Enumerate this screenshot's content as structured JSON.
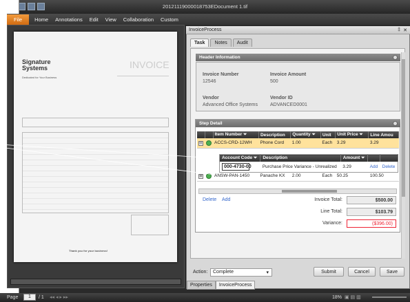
{
  "window": {
    "title": "20121119000018753EDocument 1.tif"
  },
  "menu": {
    "items": [
      "File",
      "Home",
      "Annotations",
      "Edit",
      "View",
      "Collaboration",
      "Custom"
    ]
  },
  "document": {
    "invoice_word": "INVOICE",
    "company": "Signature Systems",
    "tagline": "Dedicated for Your Business",
    "thanks": "Thank you for your business!"
  },
  "pane": {
    "title": "InvoiceProcess",
    "close": "✕",
    "pin": "‡"
  },
  "tabs": [
    "Task",
    "Notes",
    "Audit"
  ],
  "header_info": {
    "title": "Header Information",
    "invoice_number_label": "Invoice Number",
    "invoice_number": "12546",
    "invoice_amount_label": "Invoice Amount",
    "invoice_amount": "500",
    "vendor_label": "Vendor",
    "vendor": "Advanced Office Systems",
    "vendor_id_label": "Vendor ID",
    "vendor_id": "ADVANCED0001"
  },
  "step_detail": {
    "title": "Step Detail",
    "columns": [
      "Item Number",
      "Description",
      "Quantity",
      "Unit",
      "Unit Price",
      "Line Amou"
    ],
    "rows": [
      {
        "expander": "⊟",
        "item": "ACCS-CRD-12WH",
        "desc": "Phone Cord",
        "qty": "1.00",
        "unit": "Each",
        "price": "3.29",
        "amount": "3.29"
      },
      {
        "expander": "⊞",
        "item": "ANSW-PAN-1450",
        "desc": "Panache KX",
        "qty": "2.00",
        "unit": "Each",
        "price": "50.25",
        "amount": "100.50"
      }
    ],
    "sub_columns": [
      "Account Code",
      "Description",
      "Amount"
    ],
    "sub_row": {
      "account": "000-4730-00",
      "desc": "Purchase Price Variance - Unrealized",
      "amount": "3.29",
      "add": "Add",
      "delete": "Delete"
    },
    "delete": "Delete",
    "add": "Add",
    "invoice_total_label": "Invoice Total:",
    "invoice_total": "$500.00",
    "line_total_label": "Line Total:",
    "line_total": "$103.79",
    "variance_label": "Variance:",
    "variance": "($396.00)"
  },
  "actions": {
    "label": "Action:",
    "selected": "Complete",
    "submit": "Submit",
    "cancel": "Cancel",
    "save": "Save"
  },
  "bottom_tabs": [
    "Properties",
    "InvoiceProcess"
  ],
  "status": {
    "page_label": "Page",
    "page": "1",
    "of": "/ 1",
    "zoom": "18%"
  },
  "colors": {
    "accent": "#e07b1a",
    "highlight": "#ffe29c",
    "error": "#e23333"
  }
}
